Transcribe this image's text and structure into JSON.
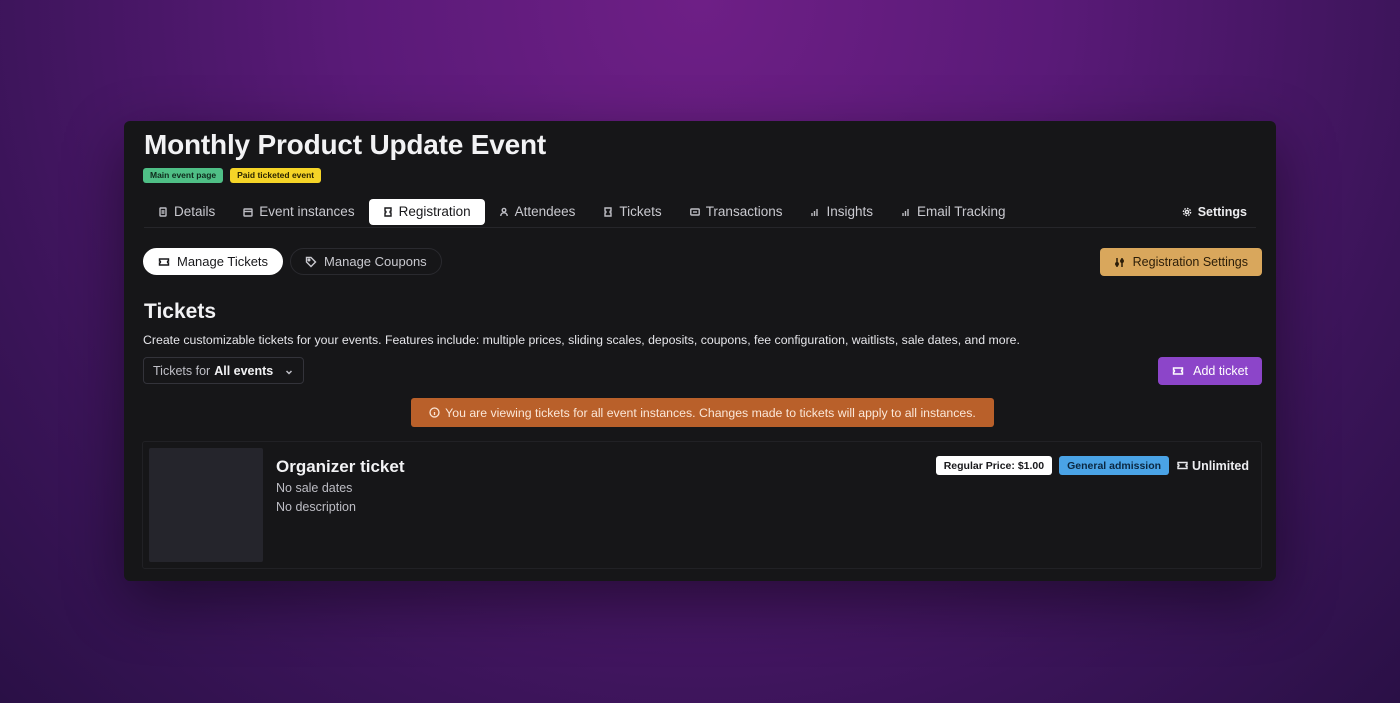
{
  "event": {
    "title": "Monthly Product Update Event",
    "badges": [
      {
        "label": "Main event page",
        "color": "#4fbf86"
      },
      {
        "label": "Paid ticketed event",
        "color": "#f5d427"
      }
    ]
  },
  "tabs": [
    {
      "label": "Details",
      "icon": "document-icon",
      "active": false
    },
    {
      "label": "Event instances",
      "icon": "calendar-icon",
      "active": false
    },
    {
      "label": "Registration",
      "icon": "ticket-icon",
      "active": true
    },
    {
      "label": "Attendees",
      "icon": "person-icon",
      "active": false
    },
    {
      "label": "Tickets",
      "icon": "ticket-icon",
      "active": false
    },
    {
      "label": "Transactions",
      "icon": "card-icon",
      "active": false
    },
    {
      "label": "Insights",
      "icon": "bar-chart-icon",
      "active": false
    },
    {
      "label": "Email Tracking",
      "icon": "bar-chart-icon",
      "active": false
    }
  ],
  "settings_label": "Settings",
  "subtabs": {
    "manage_tickets": "Manage Tickets",
    "manage_coupons": "Manage Coupons"
  },
  "registration_settings_label": "Registration Settings",
  "tickets_section": {
    "title": "Tickets",
    "description": "Create customizable tickets for your events. Features include: multiple prices, sliding scales, deposits, coupons, fee configuration, waitlists, sale dates, and more.",
    "filter_prefix": "Tickets for",
    "filter_value": "All events",
    "add_ticket_label": "Add ticket",
    "notice": "You are viewing tickets for all event instances. Changes made to tickets will apply to all instances."
  },
  "tickets": [
    {
      "name": "Organizer ticket",
      "sale_dates": "No sale dates",
      "description": "No description",
      "price_badge": "Regular Price: $1.00",
      "type_badge": "General admission",
      "quantity": "Unlimited"
    }
  ],
  "colors": {
    "accent_purple": "#8c45c9",
    "accent_gold": "#d9a75c",
    "notice_orange": "#b9602a",
    "badge_blue": "#4aa3e6"
  }
}
